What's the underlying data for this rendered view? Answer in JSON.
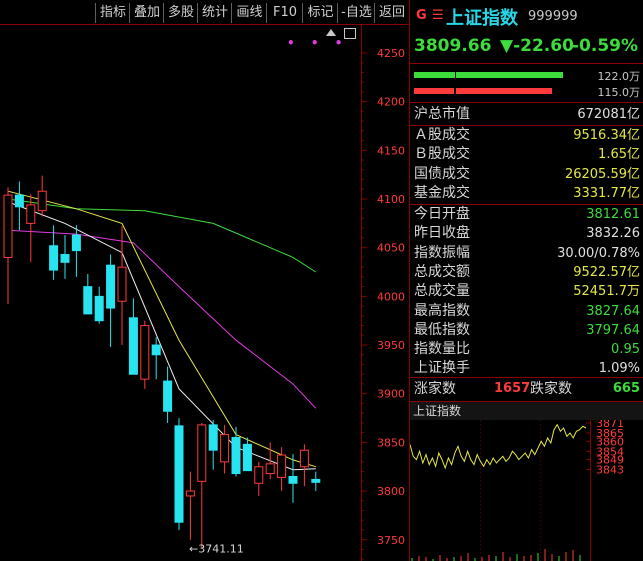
{
  "toolbar": {
    "buttons": [
      "指标",
      "叠加",
      "多股",
      "统计",
      "画线",
      "F10",
      "标记",
      "-自选",
      "返回"
    ]
  },
  "main_chart": {
    "y_ticks": [
      4250,
      4200,
      4150,
      4100,
      4050,
      4000,
      3950,
      3900,
      3850,
      3800,
      3750
    ],
    "low_marker": "3741.11",
    "colors": {
      "up": "#ff3a3a",
      "down": "#28e4f0",
      "ma5": "#f0f0f0",
      "ma10": "#e6e64a",
      "ma20": "#e03ce0",
      "ma60": "#3cdc3c",
      "axis": "#8a0000"
    },
    "candles": [
      {
        "o": 4040,
        "h": 4112,
        "l": 3992,
        "c": 4104
      },
      {
        "o": 4104,
        "h": 4118,
        "l": 4068,
        "c": 4092
      },
      {
        "o": 4075,
        "h": 4105,
        "l": 4035,
        "c": 4094
      },
      {
        "o": 4088,
        "h": 4124,
        "l": 4082,
        "c": 4108
      },
      {
        "o": 4052,
        "h": 4073,
        "l": 4017,
        "c": 4027
      },
      {
        "o": 4043,
        "h": 4063,
        "l": 4018,
        "c": 4035
      },
      {
        "o": 4063,
        "h": 4073,
        "l": 4020,
        "c": 4047
      },
      {
        "o": 4010,
        "h": 4023,
        "l": 3990,
        "c": 3982
      },
      {
        "o": 4000,
        "h": 4010,
        "l": 3972,
        "c": 3975
      },
      {
        "o": 4032,
        "h": 4043,
        "l": 3948,
        "c": 3988
      },
      {
        "o": 3995,
        "h": 4072,
        "l": 3950,
        "c": 4030
      },
      {
        "o": 3978,
        "h": 3998,
        "l": 3935,
        "c": 3920
      },
      {
        "o": 3915,
        "h": 3975,
        "l": 3905,
        "c": 3970
      },
      {
        "o": 3950,
        "h": 3958,
        "l": 3915,
        "c": 3940
      },
      {
        "o": 3913,
        "h": 3928,
        "l": 3870,
        "c": 3882
      },
      {
        "o": 3867,
        "h": 3875,
        "l": 3760,
        "c": 3768
      },
      {
        "o": 3795,
        "h": 3820,
        "l": 3750,
        "c": 3800
      },
      {
        "o": 3810,
        "h": 3870,
        "l": 3741,
        "c": 3868
      },
      {
        "o": 3868,
        "h": 3873,
        "l": 3822,
        "c": 3842
      },
      {
        "o": 3830,
        "h": 3868,
        "l": 3818,
        "c": 3858
      },
      {
        "o": 3855,
        "h": 3866,
        "l": 3815,
        "c": 3818
      },
      {
        "o": 3848,
        "h": 3855,
        "l": 3822,
        "c": 3821
      },
      {
        "o": 3808,
        "h": 3830,
        "l": 3795,
        "c": 3825
      },
      {
        "o": 3818,
        "h": 3850,
        "l": 3812,
        "c": 3828
      },
      {
        "o": 3814,
        "h": 3845,
        "l": 3800,
        "c": 3837
      },
      {
        "o": 3815,
        "h": 3838,
        "l": 3788,
        "c": 3808
      },
      {
        "o": 3825,
        "h": 3848,
        "l": 3805,
        "c": 3842
      },
      {
        "o": 3812,
        "h": 3820,
        "l": 3800,
        "c": 3809
      }
    ],
    "ma5": [
      [
        0,
        4097
      ],
      [
        5,
        4075
      ],
      [
        10,
        4045
      ],
      [
        15,
        3905
      ],
      [
        20,
        3845
      ],
      [
        25,
        3822
      ],
      [
        27,
        3823
      ]
    ],
    "ma10": [
      [
        0,
        4108
      ],
      [
        6,
        4090
      ],
      [
        10,
        4075
      ],
      [
        15,
        3955
      ],
      [
        20,
        3858
      ],
      [
        25,
        3832
      ],
      [
        27,
        3825
      ]
    ],
    "ma20": [
      [
        0,
        4068
      ],
      [
        6,
        4064
      ],
      [
        11,
        4055
      ],
      [
        15,
        4010
      ],
      [
        20,
        3955
      ],
      [
        25,
        3910
      ],
      [
        27,
        3885
      ]
    ],
    "ma60": [
      [
        0,
        4100
      ],
      [
        6,
        4090
      ],
      [
        12,
        4088
      ],
      [
        18,
        4075
      ],
      [
        22,
        4055
      ],
      [
        25,
        4040
      ],
      [
        27,
        4025
      ]
    ]
  },
  "info": {
    "g": "G",
    "menu": "☰",
    "name": "上证指数",
    "code": "999999",
    "price": "3809.66",
    "change": "▼-22.60",
    "pct": "-0.59%",
    "bar_green_value": "122.0万",
    "bar_red_value": "115.0万",
    "total_cap_label": "沪总市值",
    "total_cap_value": "672081亿",
    "rows_a": [
      {
        "label": "Ａ股成交",
        "value": "9516.34亿"
      },
      {
        "label": "Ｂ股成交",
        "value": "1.65亿"
      },
      {
        "label": "国债成交",
        "value": "26205.59亿"
      },
      {
        "label": "基金成交",
        "value": "3331.77亿"
      }
    ],
    "rows_b": [
      {
        "label": "今日开盘",
        "value": "3812.61",
        "color": "#3cdc3c"
      },
      {
        "label": "昨日收盘",
        "value": "3832.26",
        "color": "#e0e0e0"
      },
      {
        "label": "指数振幅",
        "value": "30.00/0.78%",
        "color": "#e0e0e0"
      },
      {
        "label": "总成交额",
        "value": "9522.57亿",
        "color": "#e6e64a"
      },
      {
        "label": "总成交量",
        "value": "52451.7万",
        "color": "#e6e64a"
      },
      {
        "label": "最高指数",
        "value": "3827.64",
        "color": "#3cdc3c"
      },
      {
        "label": "最低指数",
        "value": "3797.64",
        "color": "#3cdc3c"
      },
      {
        "label": "指数量比",
        "value": "0.95",
        "color": "#3cdc3c"
      },
      {
        "label": "上证换手",
        "value": "1.09%",
        "color": "#e0e0e0"
      }
    ],
    "up_label": "涨家数",
    "up_value": "1657",
    "down_label": "跌家数",
    "down_value": "665"
  },
  "mini_chart": {
    "title": "上证指数",
    "y_ticks": [
      3871,
      3865,
      3860,
      3854,
      3849,
      3843
    ],
    "line": [
      3858,
      3851,
      3849,
      3854,
      3847,
      3852,
      3846,
      3850,
      3845,
      3853,
      3849,
      3844,
      3850,
      3846,
      3853,
      3857,
      3851,
      3848,
      3854,
      3849,
      3846,
      3852,
      3848,
      3845,
      3849,
      3846,
      3850,
      3847,
      3849,
      3851,
      3848,
      3850,
      3854,
      3852,
      3849,
      3851,
      3853,
      3850,
      3855,
      3852,
      3856,
      3860,
      3857,
      3862,
      3859,
      3867,
      3870,
      3866,
      3868,
      3863,
      3865,
      3862,
      3866,
      3867,
      3869,
      3868
    ],
    "line_color": "#e6e64a"
  }
}
